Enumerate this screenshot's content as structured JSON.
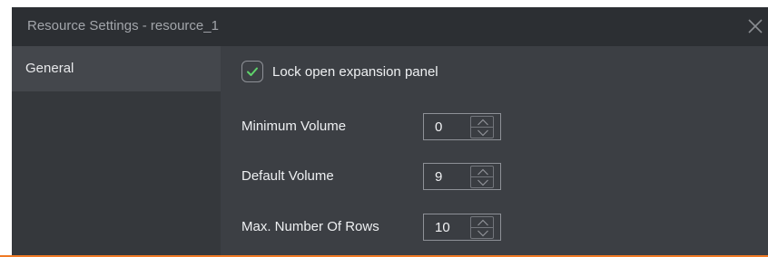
{
  "dialog": {
    "title": "Resource Settings - resource_1",
    "close_icon": "close-icon"
  },
  "sidebar": {
    "items": [
      {
        "label": "General",
        "selected": true
      }
    ]
  },
  "general": {
    "lock_panel": {
      "label": "Lock open expansion panel",
      "checked": true,
      "icon": "checkmark-icon"
    },
    "fields": [
      {
        "label": "Minimum Volume",
        "value": "0"
      },
      {
        "label": "Default Volume",
        "value": "9"
      },
      {
        "label": "Max. Number Of Rows",
        "value": "10"
      }
    ]
  },
  "colors": {
    "accent": "#f07a25",
    "check": "#5fd46b",
    "titlebar": "#2c2f33",
    "panel": "#3c3f44"
  }
}
